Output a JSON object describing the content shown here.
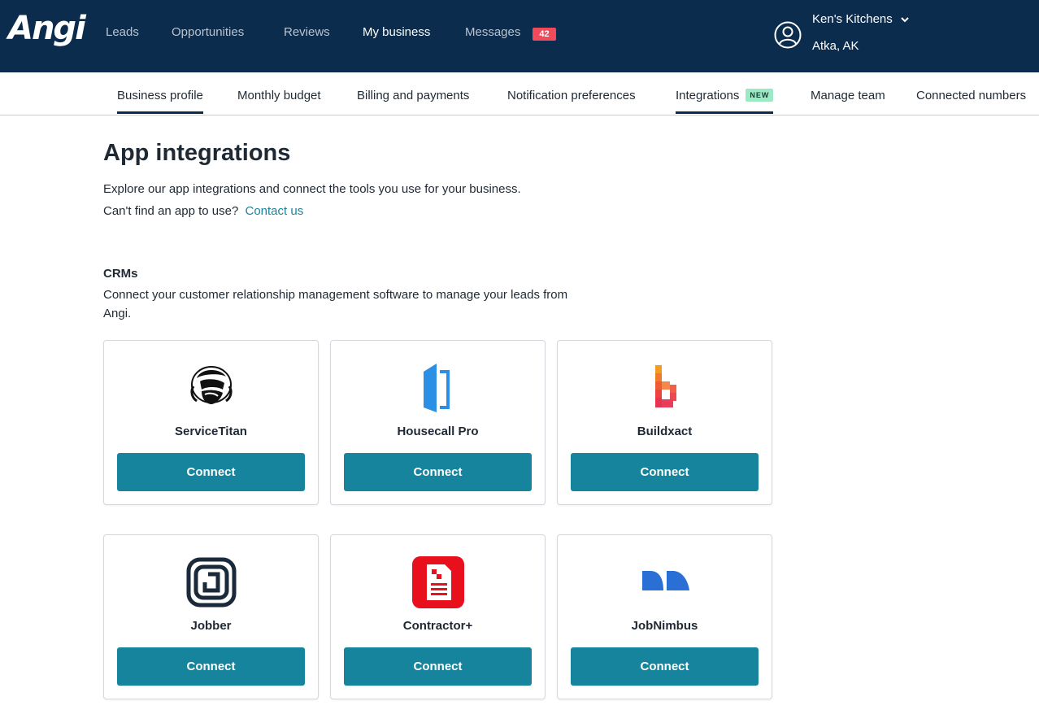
{
  "header": {
    "logo": "Angi",
    "nav": [
      {
        "label": "Leads",
        "active": false
      },
      {
        "label": "Opportunities",
        "active": false
      },
      {
        "label": "Reviews",
        "active": false
      },
      {
        "label": "My business",
        "active": true
      },
      {
        "label": "Messages",
        "active": false
      }
    ],
    "messages_count": "42",
    "account": {
      "name": "Ken's Kitchens",
      "location": "Atka, AK",
      "icon": "user-circle-icon"
    }
  },
  "subtabs": [
    {
      "label": "Business profile",
      "active": true
    },
    {
      "label": "Monthly budget",
      "active": false
    },
    {
      "label": "Billing and payments",
      "active": false
    },
    {
      "label": "Notification preferences",
      "active": false
    },
    {
      "label": "Integrations",
      "active": true,
      "badge": "NEW"
    },
    {
      "label": "Manage team",
      "active": false
    },
    {
      "label": "Connected numbers",
      "active": false
    }
  ],
  "page": {
    "title": "App integrations",
    "intro": "Explore our app integrations and connect the tools you use for your business.",
    "cant_find": "Can't find an app to use?",
    "contact_link": "Contact us"
  },
  "crms": {
    "title": "CRMs",
    "description": "Connect your customer relationship management software to manage your leads from Angi.",
    "apps": [
      {
        "name": "ServiceTitan",
        "icon": "servicetitan-logo-icon",
        "button": "Connect"
      },
      {
        "name": "Housecall Pro",
        "icon": "housecall-pro-logo-icon",
        "button": "Connect"
      },
      {
        "name": "Buildxact",
        "icon": "buildxact-logo-icon",
        "button": "Connect"
      },
      {
        "name": "Jobber",
        "icon": "jobber-logo-icon",
        "button": "Connect"
      },
      {
        "name": "Contractor+",
        "icon": "contractor-plus-logo-icon",
        "button": "Connect"
      },
      {
        "name": "JobNimbus",
        "icon": "jobnimbus-logo-icon",
        "button": "Connect"
      }
    ]
  },
  "colors": {
    "header_bg": "#0c2c4d",
    "accent": "#16849d",
    "link": "#1a8599",
    "badge": "#ef4b5a",
    "new_pill": "#9ce9c6"
  }
}
